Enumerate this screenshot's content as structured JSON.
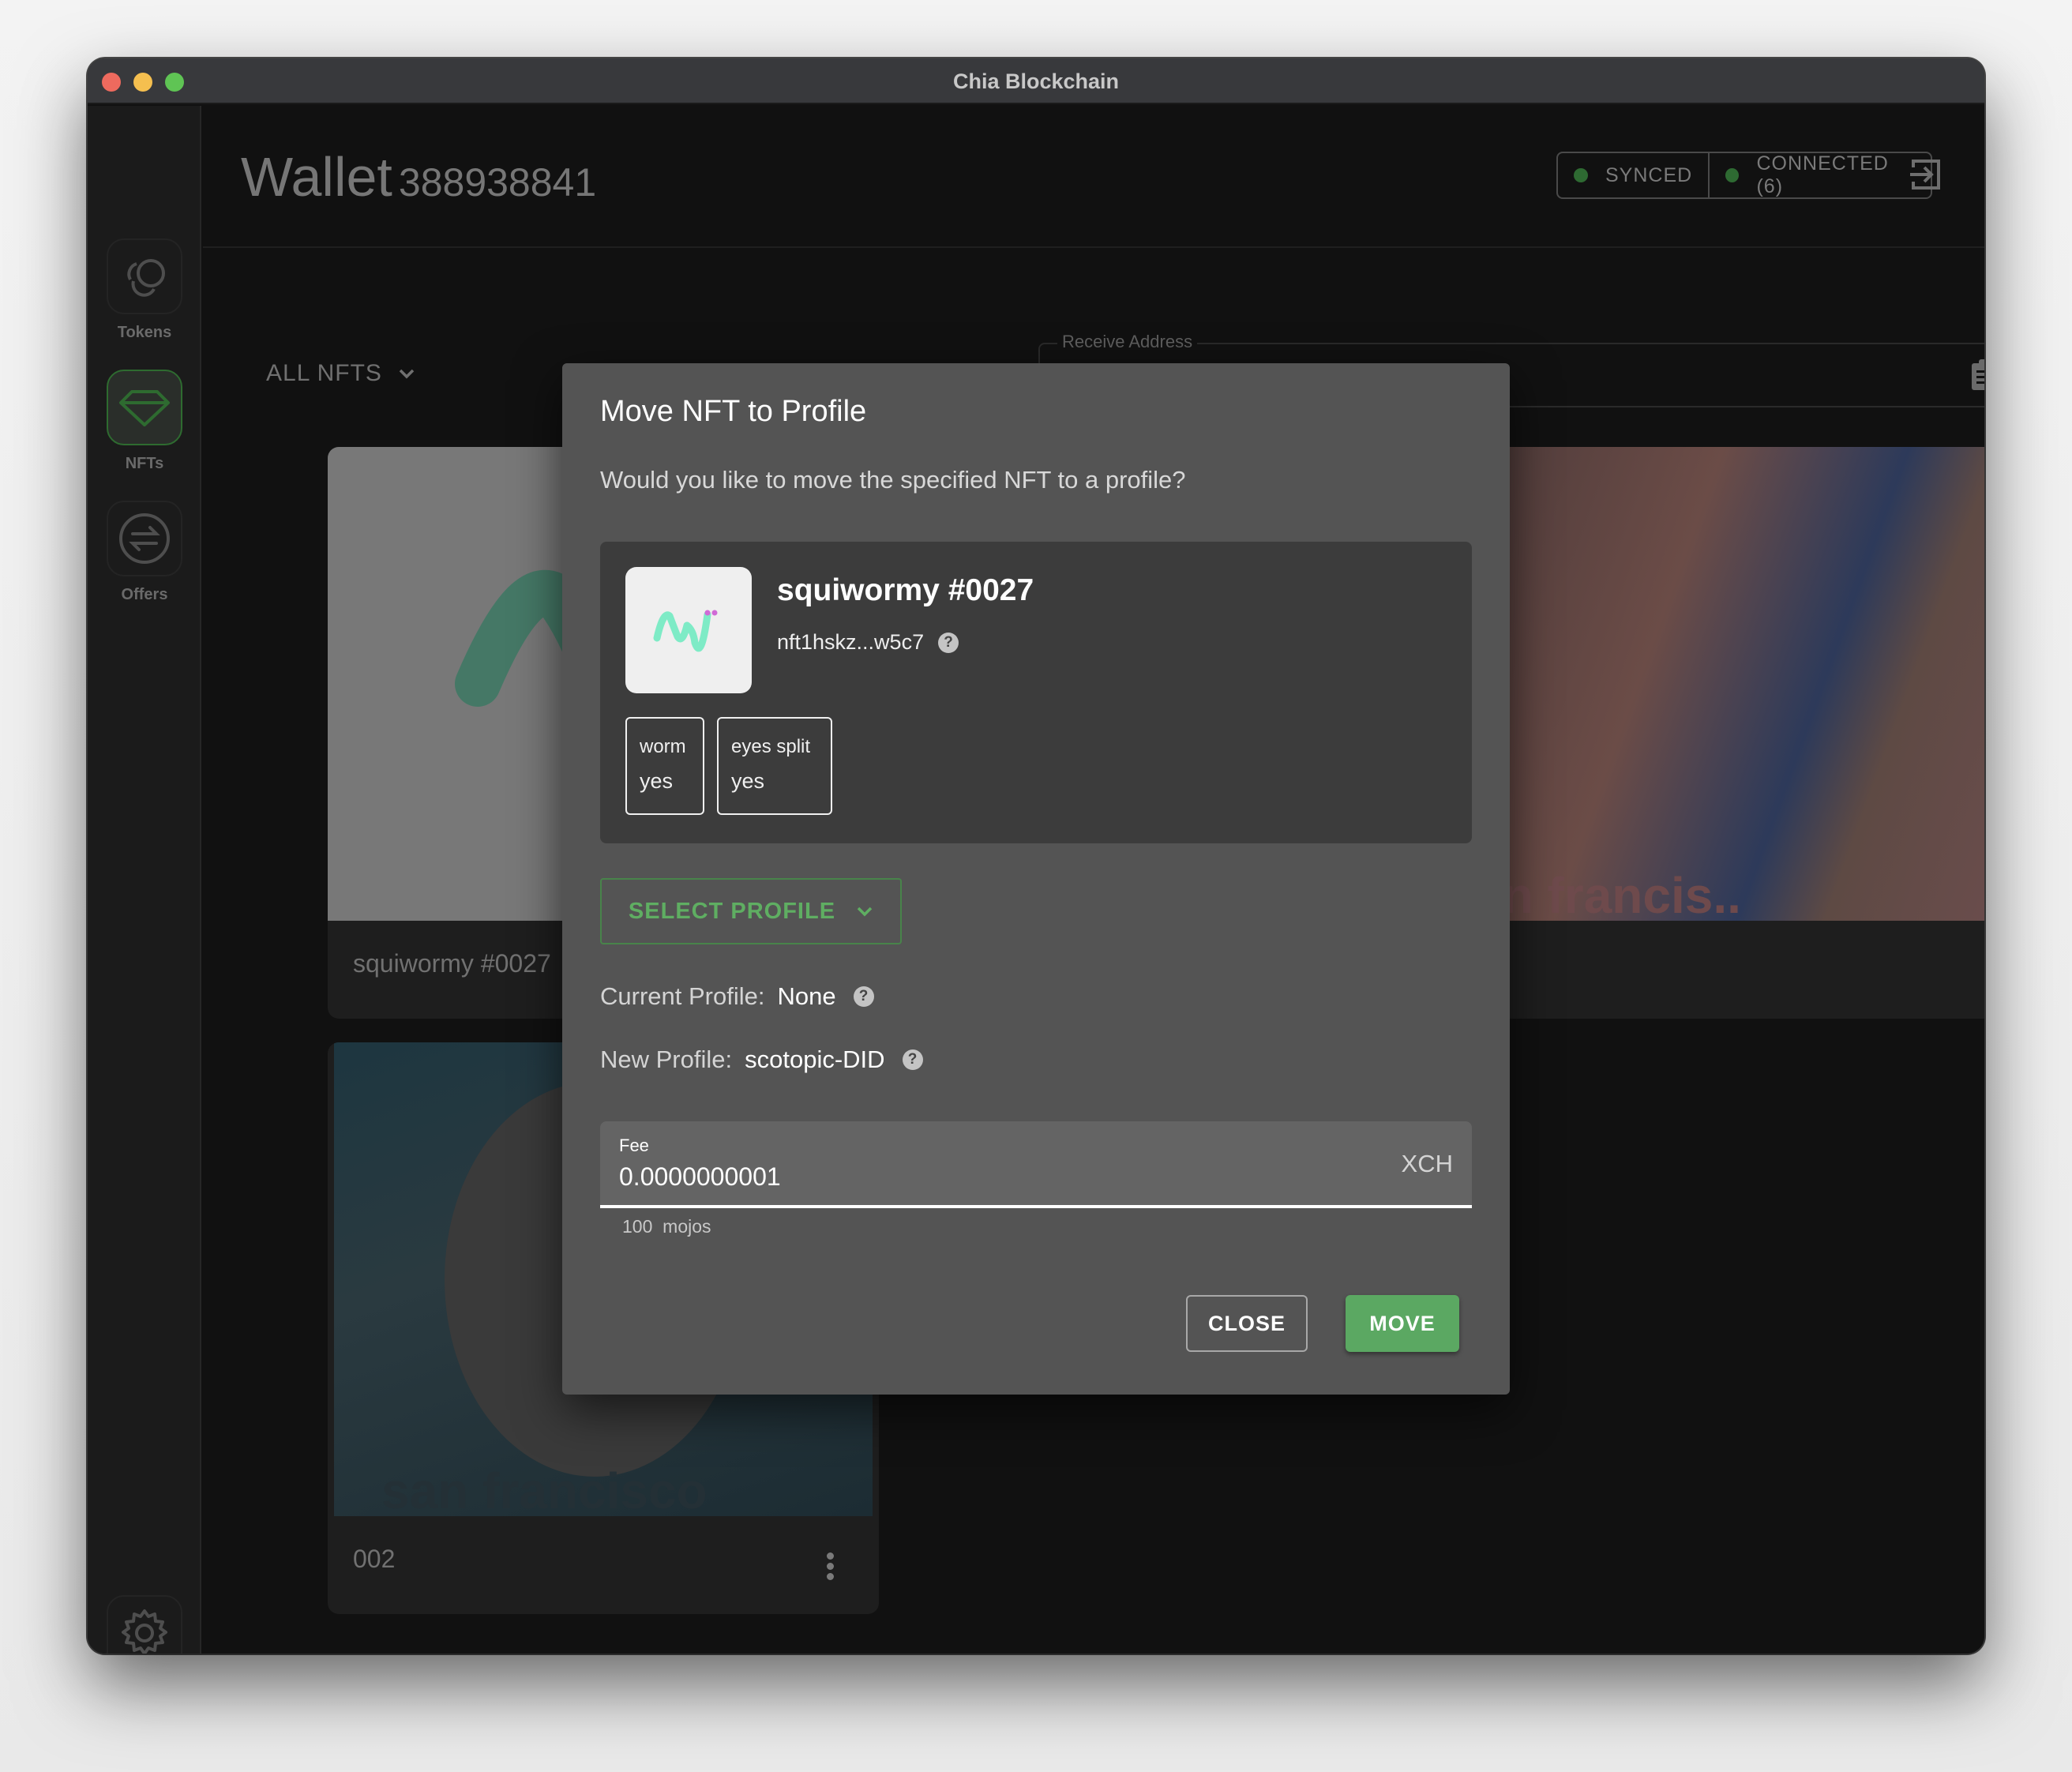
{
  "window": {
    "title": "Chia Blockchain"
  },
  "sidebar": {
    "items": [
      {
        "label": "Tokens",
        "icon": "tokens-icon",
        "active": false
      },
      {
        "label": "NFTs",
        "icon": "gem-icon",
        "active": true
      },
      {
        "label": "Offers",
        "icon": "swap-icon",
        "active": false
      },
      {
        "label": "Settings",
        "icon": "gear-icon",
        "active": false
      }
    ]
  },
  "header": {
    "title": "Wallet",
    "wallet_id": "388938841",
    "status": {
      "synced": "SYNCED",
      "connected": "CONNECTED (6)"
    },
    "status_color": "#2e6a32"
  },
  "toolbar": {
    "filter_label": "ALL NFTS",
    "receive_address_label": "Receive Address",
    "receive_address_value": ""
  },
  "gallery": {
    "cards": [
      {
        "name": "squiwormy #0027"
      },
      {
        "name": ""
      },
      {
        "name": "002"
      }
    ]
  },
  "dialog": {
    "title": "Move NFT to Profile",
    "description": "Would you like to move the specified NFT to a profile?",
    "nft": {
      "name": "squiwormy #0027",
      "id": "nft1hskz...w5c7",
      "attributes": [
        {
          "key": "worm",
          "value": "yes"
        },
        {
          "key": "eyes split",
          "value": "yes"
        }
      ]
    },
    "select_profile_label": "SELECT PROFILE",
    "current_profile_label": "Current Profile:",
    "current_profile_value": "None",
    "new_profile_label": "New Profile:",
    "new_profile_value": "scotopic-DID",
    "fee": {
      "label": "Fee",
      "value": "0.0000000001",
      "unit": "XCH",
      "helper_amount": "100",
      "helper_unit": "mojos"
    },
    "close_label": "CLOSE",
    "move_label": "MOVE",
    "accent_color": "#5ba862"
  }
}
